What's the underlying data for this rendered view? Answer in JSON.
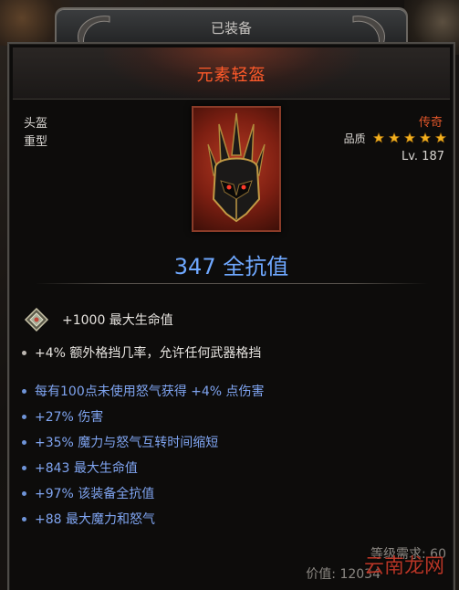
{
  "header": {
    "tab_label": "已装备"
  },
  "item": {
    "name": "元素轻盔",
    "slot": "头盔",
    "weight_class": "重型",
    "rarity": "传奇",
    "quality_label": "品质",
    "quality_stars": 5,
    "level": "Lv. 187",
    "armor_value": "347 全抗值"
  },
  "gem": {
    "text": "+1000 最大生命值"
  },
  "affixes": [
    {
      "text": "+4% 额外格挡几率，允许任何武器格挡",
      "color": "white"
    },
    {
      "text": "每有100点未使用怒气获得 +4% 点伤害",
      "color": "blue"
    },
    {
      "text": "+27% 伤害",
      "color": "blue"
    },
    {
      "text": "+35% 魔力与怒气互转时间缩短",
      "color": "blue"
    },
    {
      "text": "+843 最大生命值",
      "color": "blue"
    },
    {
      "text": "+97% 该装备全抗值",
      "color": "blue"
    },
    {
      "text": "+88 最大魔力和怒气",
      "color": "blue"
    }
  ],
  "footer": {
    "requirement": "等级需求: 60",
    "price": "价值: 12034"
  },
  "watermark": "云南龙网",
  "colors": {
    "name": "#ff5a2a",
    "rarity": "#e0562a",
    "armor": "#6fa8ff",
    "affix_blue": "#7fa4f0",
    "affix_white": "#e6e3df",
    "star": "#f2b01e"
  }
}
